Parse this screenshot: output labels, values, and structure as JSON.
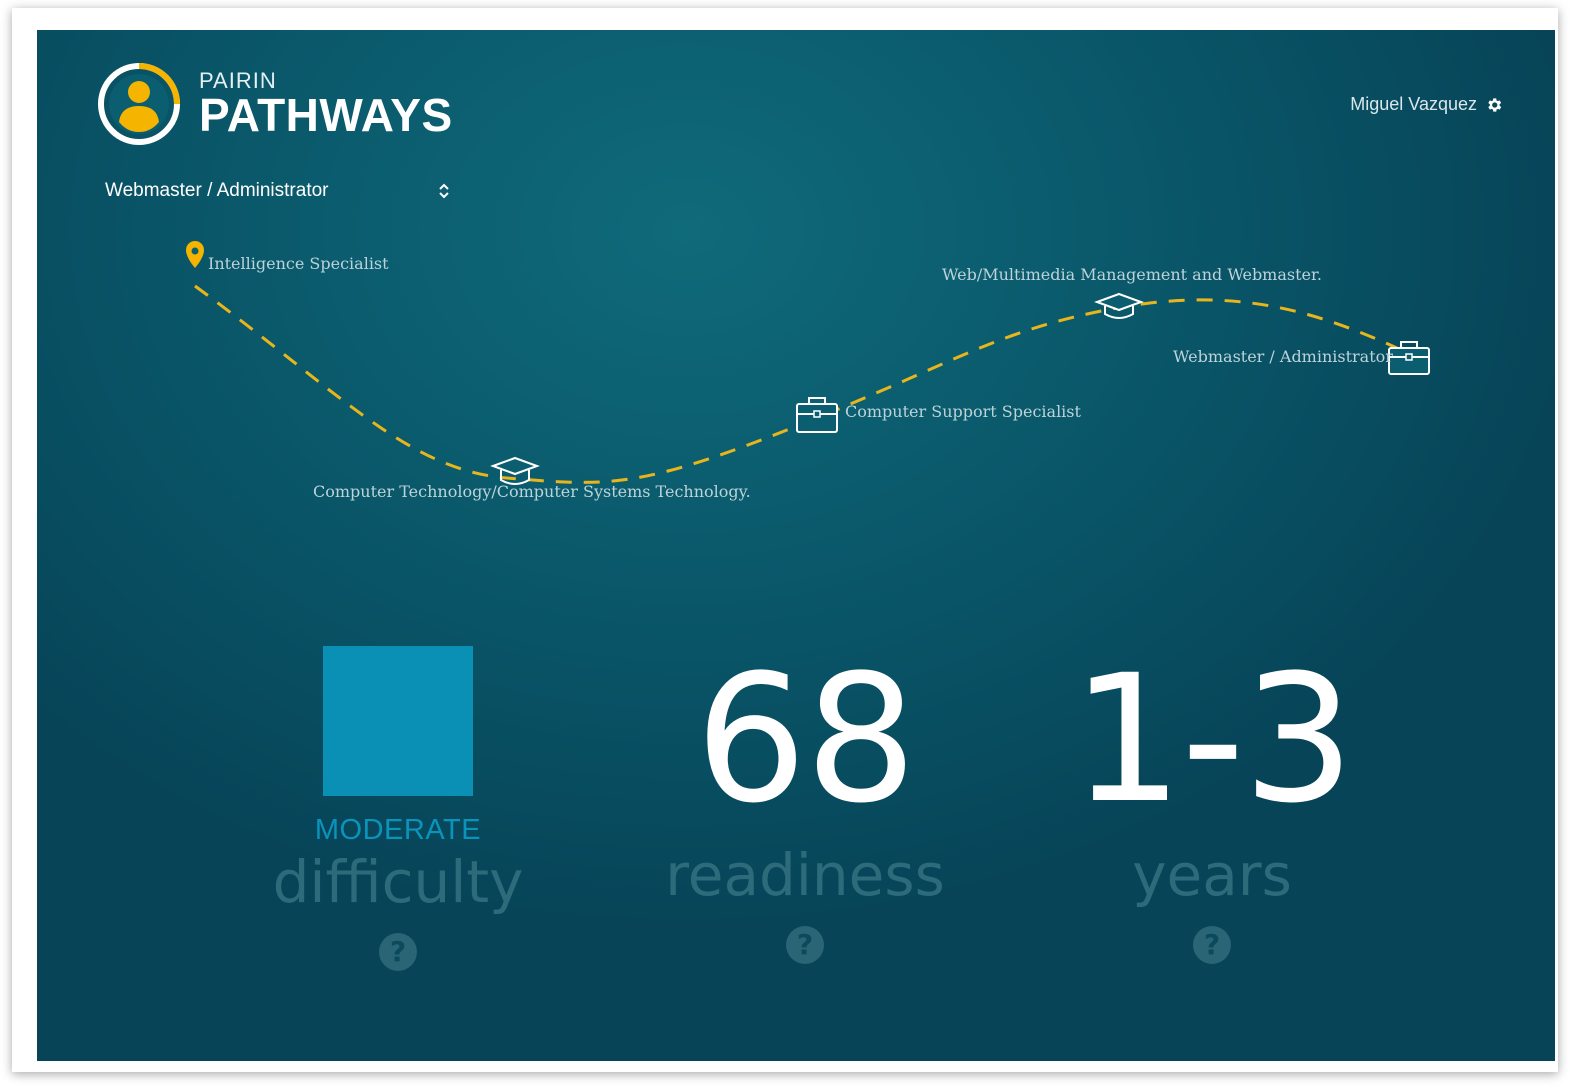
{
  "brand": {
    "small": "PAIRIN",
    "big": "PATHWAYS"
  },
  "user": {
    "name": "Miguel Vazquez",
    "icon": "gear-icon"
  },
  "pathway_select": {
    "value": "Webmaster / Administrator",
    "icon": "sort-arrows-icon"
  },
  "pathway": {
    "line_color": "#e8b61c",
    "nodes": [
      {
        "type": "start",
        "icon": "location-pin-icon",
        "label": "Intelligence Specialist"
      },
      {
        "type": "education",
        "icon": "graduation-cap-icon",
        "label": "Computer Technology/Computer Systems Technology."
      },
      {
        "type": "job",
        "icon": "briefcase-icon",
        "label": "Computer Support Specialist"
      },
      {
        "type": "education",
        "icon": "graduation-cap-icon",
        "label": "Web/Multimedia Management and Webmaster."
      },
      {
        "type": "job",
        "icon": "briefcase-icon",
        "label": "Webmaster / Administrator"
      }
    ]
  },
  "metrics": {
    "difficulty": {
      "level": "MODERATE",
      "label": "difficulty",
      "help": "?",
      "color": "#0a8fb5"
    },
    "readiness": {
      "value": "68",
      "label": "readiness",
      "help": "?"
    },
    "years": {
      "value": "1-3",
      "label": "years",
      "help": "?"
    }
  },
  "colors": {
    "background_light": "#0f6a7a",
    "background_dark": "#074458",
    "accent": "#f4b400",
    "muted_label": "#2d6b7b"
  }
}
